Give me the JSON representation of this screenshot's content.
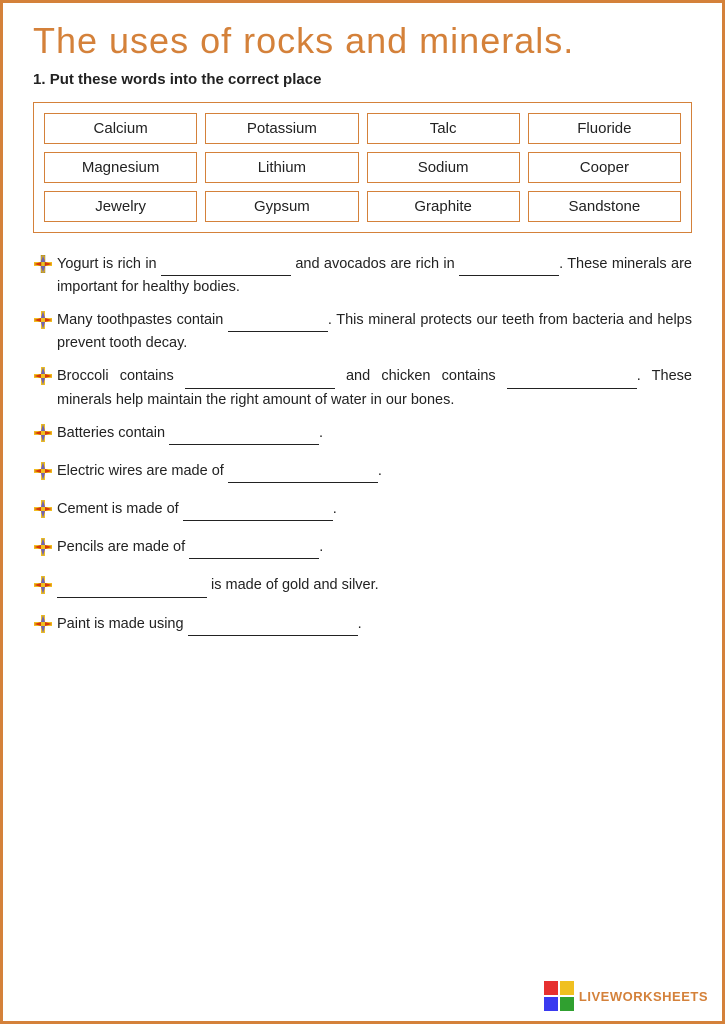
{
  "title": "The uses of rocks and minerals.",
  "instruction_number": "1.",
  "instruction_text": "Put these words into the correct place",
  "word_bank": [
    "Calcium",
    "Potassium",
    "Talc",
    "Fluoride",
    "Magnesium",
    "Lithium",
    "Sodium",
    "Cooper",
    "Jewelry",
    "Gypsum",
    "Graphite",
    "Sandstone"
  ],
  "sentences": [
    {
      "id": 1,
      "text": "Yogurt is rich in ___ and avocados are rich in ___. These minerals are important for healthy bodies.",
      "blank1_size": "lg",
      "blank2_size": "md"
    },
    {
      "id": 2,
      "text": "Many toothpastes contain ___. This mineral protects our teeth from bacteria and helps prevent tooth decay.",
      "blank1_size": "md"
    },
    {
      "id": 3,
      "text": "Broccoli contains ___ and chicken contains ___. These minerals help maintain the right amount of water in our bones.",
      "blank1_size": "xl",
      "blank2_size": "lg"
    },
    {
      "id": 4,
      "text": "Batteries contain ___.",
      "blank1_size": "xl"
    },
    {
      "id": 5,
      "text": "Electric wires are made of ___.",
      "blank1_size": "xl"
    },
    {
      "id": 6,
      "text": "Cement is made of ___.",
      "blank1_size": "xl"
    },
    {
      "id": 7,
      "text": "Pencils are made of ___.",
      "blank1_size": "lg"
    },
    {
      "id": 8,
      "text": "___ is made of gold and silver.",
      "blank1_size": "xl"
    },
    {
      "id": 9,
      "text": "Paint is made using ___.",
      "blank1_size": "xxl"
    }
  ],
  "liveworksheets_label": "LIVEWORKSHEETS"
}
